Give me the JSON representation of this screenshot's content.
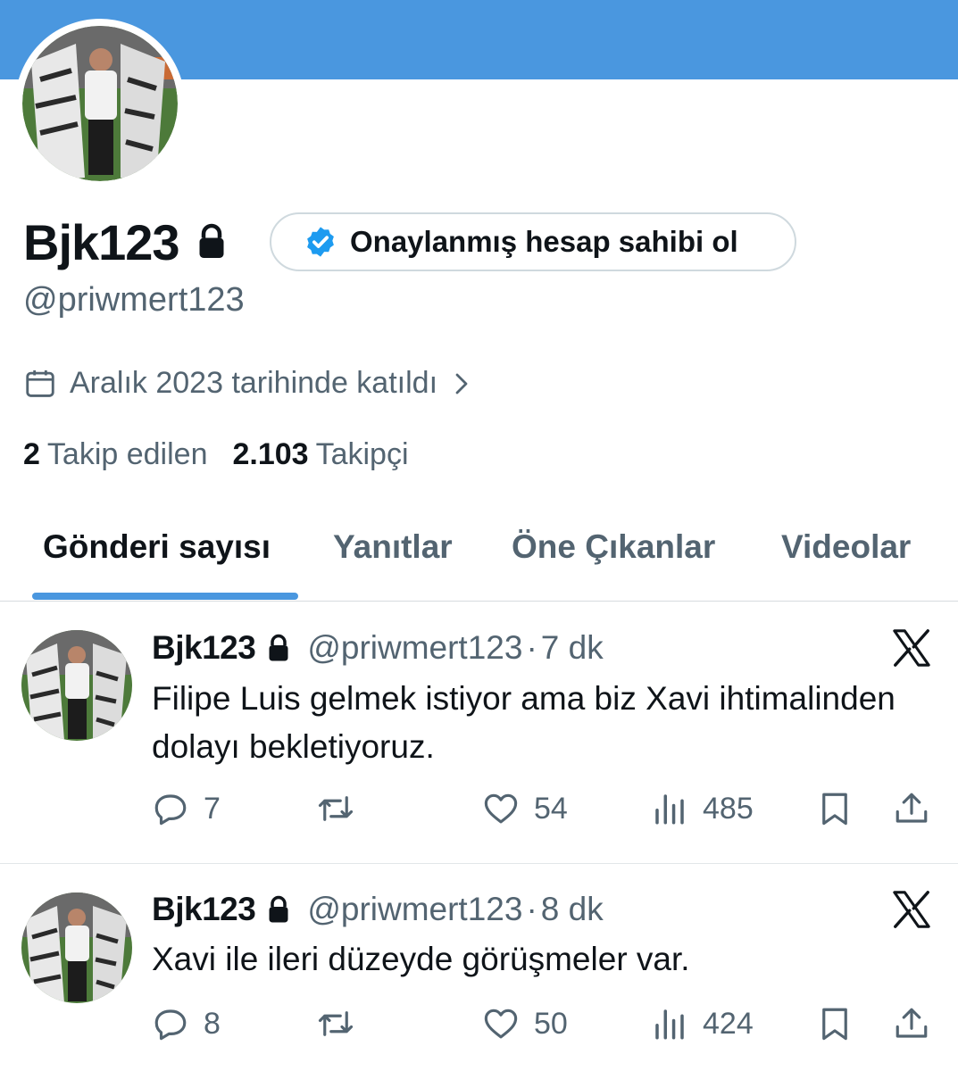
{
  "profile": {
    "display_name": "Bjk123",
    "handle": "@priwmert123",
    "verify_button": "Onaylanmış hesap sahibi ol",
    "joined": "Aralık 2023 tarihinde katıldı",
    "following_count": "2",
    "following_label": "Takip edilen",
    "followers_count": "2.103",
    "followers_label": "Takipçi"
  },
  "tabs": [
    {
      "label": "Gönderi sayısı",
      "active": true
    },
    {
      "label": "Yanıtlar",
      "active": false
    },
    {
      "label": "Öne Çıkanlar",
      "active": false
    },
    {
      "label": "Videolar",
      "active": false
    }
  ],
  "tweets": [
    {
      "name": "Bjk123",
      "handle": "@priwmert123",
      "separator": "·",
      "time": "7 dk",
      "text": "Filipe Luis gelmek istiyor ama biz Xavi ihtimalinden dolayı bekletiyoruz.",
      "replies": "7",
      "retweets": "",
      "likes": "54",
      "views": "485"
    },
    {
      "name": "Bjk123",
      "handle": "@priwmert123",
      "separator": "·",
      "time": "8 dk",
      "text": "Xavi ile ileri düzeyde görüşmeler var.",
      "replies": "8",
      "retweets": "",
      "likes": "50",
      "views": "424"
    }
  ],
  "colors": {
    "banner": "#4a97df",
    "accent": "#4a97df",
    "verified": "#1d9bf0",
    "muted_text": "#536471",
    "primary_text": "#0f1419"
  },
  "icons": {
    "lock": "lock-icon",
    "verified": "verified-badge-icon",
    "calendar": "calendar-icon",
    "chevron": "chevron-right-icon",
    "x_logo": "x-logo-icon",
    "reply": "reply-icon",
    "retweet": "retweet-icon",
    "like": "heart-icon",
    "views": "views-icon",
    "bookmark": "bookmark-icon",
    "share": "share-icon"
  }
}
